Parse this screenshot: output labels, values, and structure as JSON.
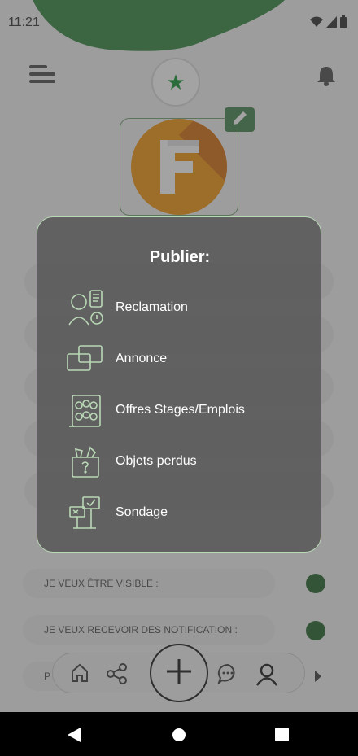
{
  "status_bar": {
    "time": "11:21"
  },
  "profile": {
    "avatar_letter": "F"
  },
  "publish_modal": {
    "title": "Publier:",
    "items": [
      {
        "label": "Reclamation",
        "icon": "complaint-person-icon"
      },
      {
        "label": "Annonce",
        "icon": "announcement-cards-icon"
      },
      {
        "label": "Offres Stages/Emplois",
        "icon": "job-offers-group-icon"
      },
      {
        "label": "Objets perdus",
        "icon": "lost-items-box-icon"
      },
      {
        "label": "Sondage",
        "icon": "poll-signs-icon"
      }
    ]
  },
  "settings": {
    "visible_label": "JE VEUX ÊTRE VISIBLE :",
    "notifications_label": "JE VEUX RECEVOIR DES NOTIFICATION :",
    "third_label_partial": "P"
  },
  "colors": {
    "header_green": "#3d8a48",
    "avatar_orange": "#f39a1c",
    "accent_green": "#2f6b35",
    "modal_border": "#b9d8b6"
  }
}
